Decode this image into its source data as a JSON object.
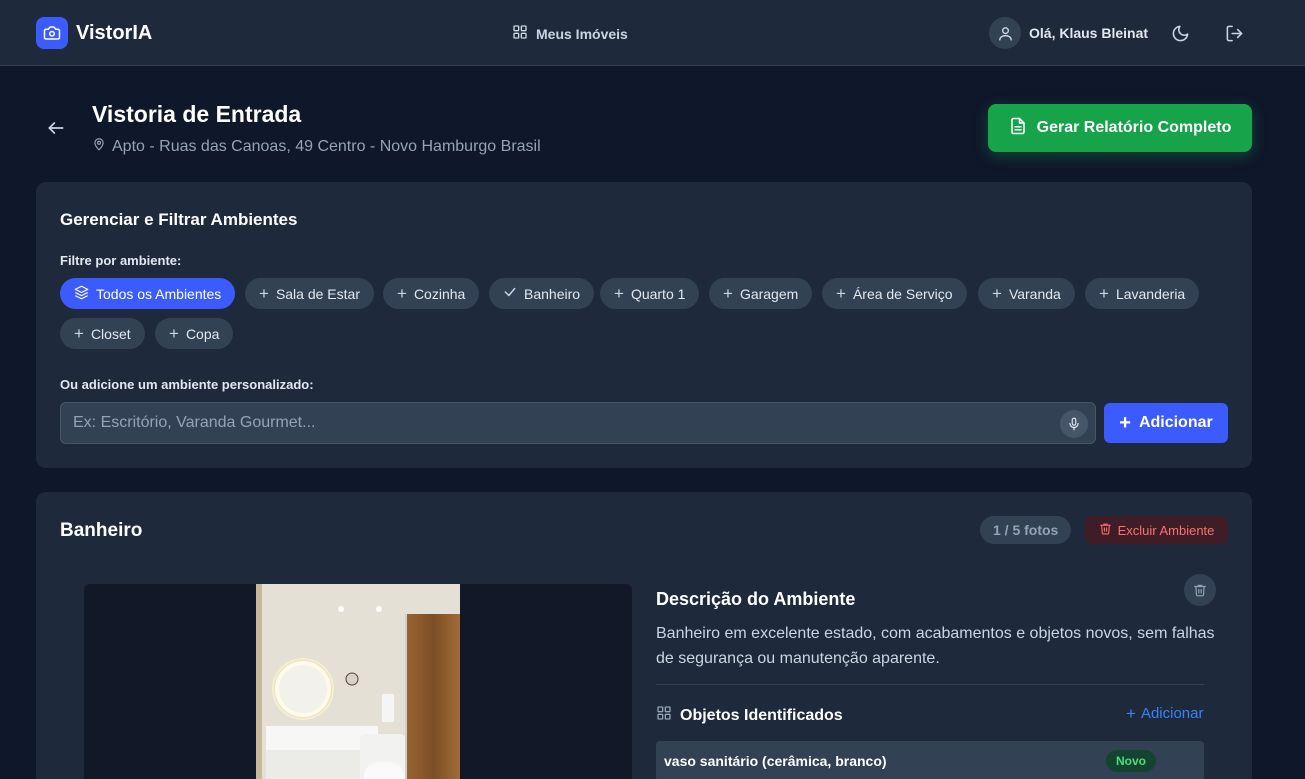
{
  "header": {
    "brand": "VistorIA",
    "nav_link": "Meus Imóveis",
    "greeting": "Olá, Klaus Bleinat"
  },
  "page": {
    "title": "Vistoria de Entrada",
    "address": "Apto - Ruas das Canoas, 49 Centro - Novo Hamburgo Brasil",
    "report_button": "Gerar Relatório Completo"
  },
  "filter_card": {
    "title": "Gerenciar e Filtrar Ambientes",
    "filter_label": "Filtre por ambiente:",
    "chips": [
      {
        "label": "Todos os Ambientes",
        "icon": "layers-icon",
        "state": "active"
      },
      {
        "label": "Sala de Estar",
        "icon": "plus-icon",
        "state": "add"
      },
      {
        "label": "Cozinha",
        "icon": "plus-icon",
        "state": "add"
      },
      {
        "label": "Banheiro",
        "icon": "check-icon",
        "state": "added"
      },
      {
        "label": "Quarto 1",
        "icon": "plus-icon",
        "state": "add"
      },
      {
        "label": "Garagem",
        "icon": "plus-icon",
        "state": "add"
      },
      {
        "label": "Área de Serviço",
        "icon": "plus-icon",
        "state": "add"
      },
      {
        "label": "Varanda",
        "icon": "plus-icon",
        "state": "add"
      },
      {
        "label": "Lavanderia",
        "icon": "plus-icon",
        "state": "add"
      },
      {
        "label": "Closet",
        "icon": "plus-icon",
        "state": "add"
      },
      {
        "label": "Copa",
        "icon": "plus-icon",
        "state": "add"
      }
    ],
    "custom_label": "Ou adicione um ambiente personalizado:",
    "custom_placeholder": "Ex: Escritório, Varanda Gourmet...",
    "add_button": "Adicionar"
  },
  "room": {
    "title": "Banheiro",
    "photo_count": "1 / 5 fotos",
    "delete_button": "Excluir Ambiente",
    "description_heading": "Descrição do Ambiente",
    "description": "Banheiro em excelente estado, com acabamentos e objetos novos, sem falhas de segurança ou manutenção aparente.",
    "objects_heading": "Objetos Identificados",
    "objects_add": "Adicionar",
    "objects": [
      {
        "name": "vaso sanitário (cerâmica, branco)",
        "badge": "Novo"
      }
    ]
  },
  "colors": {
    "background": "#0f172a",
    "card": "#1e293b",
    "accent": "#3b5bfd",
    "success": "#16a34a",
    "danger": "#f87171"
  }
}
